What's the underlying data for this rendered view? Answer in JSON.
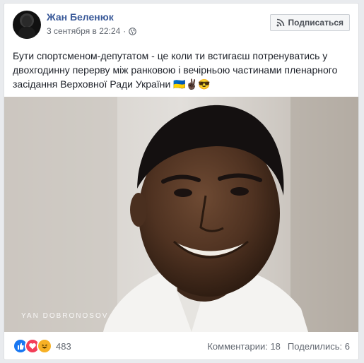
{
  "post": {
    "author": "Жан Беленюк",
    "timestamp": "3 сентября в 22:24",
    "privacy_icon": "globe-icon",
    "subscribe_label": "Подписаться",
    "text": "Бути спортсменом-депутатом - це коли ти встигаєш потренуватись у двохгодинну перерву між ранковою і вечірньою частинами пленарного засідання Верховної Ради України 🇺🇦✌🏿😎",
    "photo_watermark": "YAN DOBRONOSOV"
  },
  "footer": {
    "reaction_icons": [
      "like-icon",
      "love-icon",
      "haha-icon"
    ],
    "reaction_count": "483",
    "comments": "Комментарии: 18",
    "shares": "Поделились: 6"
  },
  "colors": {
    "link": "#385898",
    "like": "#1877f2",
    "love": "#f33e58",
    "haha": "#f7b125"
  }
}
